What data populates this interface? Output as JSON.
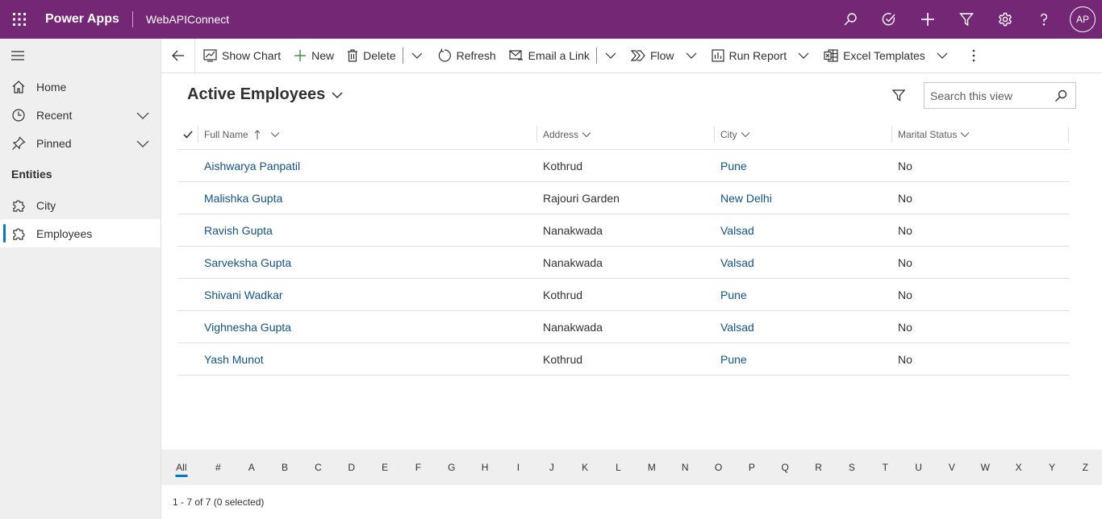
{
  "header": {
    "brand": "Power Apps",
    "app_name": "WebAPIConnect",
    "user_initials": "AP",
    "icons": [
      "search-icon",
      "task-icon",
      "plus-icon",
      "filter-icon",
      "gear-icon",
      "help-icon"
    ]
  },
  "sidebar": {
    "items": [
      {
        "label": "Home",
        "icon": "home-icon"
      },
      {
        "label": "Recent",
        "icon": "clock-icon"
      },
      {
        "label": "Pinned",
        "icon": "pin-icon"
      }
    ],
    "section_heading": "Entities",
    "entities": [
      {
        "label": "City",
        "icon": "puzzle-icon"
      },
      {
        "label": "Employees",
        "icon": "puzzle-icon"
      }
    ]
  },
  "toolbar": {
    "show_chart": "Show Chart",
    "new": "New",
    "delete": "Delete",
    "refresh": "Refresh",
    "email_link": "Email a Link",
    "flow": "Flow",
    "run_report": "Run Report",
    "excel_templates": "Excel Templates"
  },
  "view": {
    "title": "Active Employees",
    "search_placeholder": "Search this view"
  },
  "grid": {
    "columns": [
      "Full Name",
      "Address",
      "City",
      "Marital Status"
    ],
    "rows": [
      {
        "name": "Aishwarya Panpatil",
        "address": "Kothrud",
        "city": "Pune",
        "marital": "No"
      },
      {
        "name": "Malishka Gupta",
        "address": "Rajouri Garden",
        "city": "New Delhi",
        "marital": "No"
      },
      {
        "name": "Ravish Gupta",
        "address": "Nanakwada",
        "city": "Valsad",
        "marital": "No"
      },
      {
        "name": "Sarveksha Gupta",
        "address": "Nanakwada",
        "city": "Valsad",
        "marital": "No"
      },
      {
        "name": "Shivani Wadkar",
        "address": "Kothrud",
        "city": "Pune",
        "marital": "No"
      },
      {
        "name": "Vighnesha Gupta",
        "address": "Nanakwada",
        "city": "Valsad",
        "marital": "No"
      },
      {
        "name": "Yash Munot",
        "address": "Kothrud",
        "city": "Pune",
        "marital": "No"
      }
    ]
  },
  "jumpbar": [
    "All",
    "#",
    "A",
    "B",
    "C",
    "D",
    "E",
    "F",
    "G",
    "H",
    "I",
    "J",
    "K",
    "L",
    "M",
    "N",
    "O",
    "P",
    "Q",
    "R",
    "S",
    "T",
    "U",
    "V",
    "W",
    "X",
    "Y",
    "Z"
  ],
  "footer": {
    "status": "1 - 7 of 7 (0 selected)"
  }
}
